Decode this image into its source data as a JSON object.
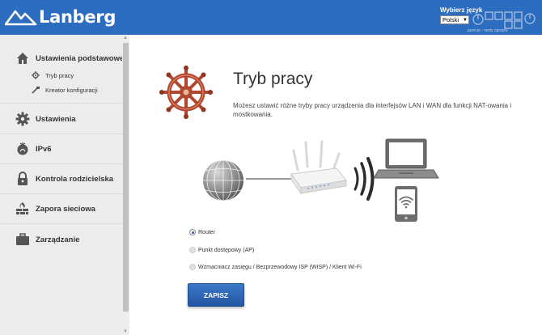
{
  "header": {
    "brand": "Lanberg",
    "language_label": "Wybierz język",
    "language_selected": "Polski",
    "watermark": "PURE PC",
    "watermark_tag": "pure pc - testy sprzętu"
  },
  "sidebar": {
    "items": [
      {
        "label": "Ustawienia podstawowe",
        "icon": "home-icon"
      },
      {
        "label": "Ustawienia",
        "icon": "gear-icon"
      },
      {
        "label": "IPv6",
        "icon": "ipv6-icon"
      },
      {
        "label": "Kontrola rodzicielska",
        "icon": "lock-icon"
      },
      {
        "label": "Zapora sieciowa",
        "icon": "firewall-icon"
      },
      {
        "label": "Zarządzanie",
        "icon": "briefcase-icon"
      }
    ],
    "subitems": [
      {
        "label": "Tryb pracy",
        "icon": "wheel-icon"
      },
      {
        "label": "Kreator konfiguracji",
        "icon": "wand-icon"
      }
    ]
  },
  "main": {
    "title": "Tryb pracy",
    "description": "Możesz ustawić różne tryby pracy urządzenia dla interfejsów LAN i WAN dla funkcji NAT-owania i mostkowania.",
    "options": [
      {
        "label": "Router",
        "checked": true
      },
      {
        "label": "Punkt dostępowy (AP)",
        "checked": false
      },
      {
        "label": "Wzmacniacz zasięgu / Bezprzewodowy ISP (WISP) / Klient Wi-Fi",
        "checked": false
      }
    ],
    "save_label": "ZAPISZ"
  },
  "colors": {
    "header": "#2d6dbf",
    "sidebar": "#ececec",
    "button": "#2a60b0",
    "helm": "#b0472e"
  }
}
